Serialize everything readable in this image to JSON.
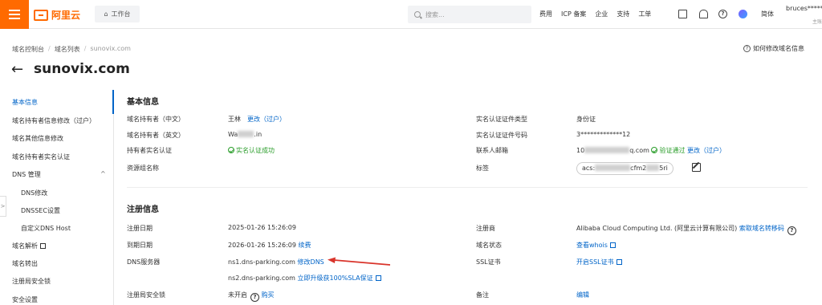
{
  "topbar": {
    "logo_text": "阿里云",
    "workbench_label": "工作台",
    "search_placeholder": "搜索...",
    "nav_links": [
      "费用",
      "ICP 备案",
      "企业",
      "支持",
      "工单"
    ],
    "language": "简体",
    "user_name": "bruces******",
    "user_sub": "主账"
  },
  "breadcrumb": [
    "域名控制台",
    "域名列表",
    "sunovix.com"
  ],
  "howto_label": "如何修改域名信息",
  "page_title": "sunovix.com",
  "sidebar": {
    "items": [
      "基本信息",
      "域名持有者信息修改（过户）",
      "域名其他信息修改",
      "域名持有者实名认证",
      "DNS 管理",
      "DNS修改",
      "DNSSEC设置",
      "自定义DNS Host",
      "域名解析",
      "域名转出",
      "注册局安全锁",
      "安全设置"
    ]
  },
  "basic_info": {
    "title": "基本信息",
    "holder_cn_label": "域名持有者（中文）",
    "holder_cn_value": "王林",
    "holder_cn_link": "更改（过户）",
    "holder_en_label": "域名持有者（英文）",
    "holder_en_prefix": "Wa",
    "holder_en_suffix": ".in",
    "realname_label": "持有者实名认证",
    "realname_value": "实名认证成功",
    "resource_group_label": "资源组名称",
    "cert_type_label": "实名认证证件类型",
    "cert_type_value": "身份证",
    "cert_no_label": "实名认证证件号码",
    "cert_no_value": "3*************12",
    "email_label": "联系人邮箱",
    "email_prefix": "10",
    "email_suffix": "q.com",
    "email_verified": "验证通过",
    "email_link": "更改（过户）",
    "tag_label": "标签",
    "tag_value_prefix": "acs:",
    "tag_value_mid": "cfm2",
    "tag_value_suffix": "5ri"
  },
  "register_info": {
    "title": "注册信息",
    "reg_date_label": "注册日期",
    "reg_date_value": "2025-01-26 15:26:09",
    "exp_date_label": "到期日期",
    "exp_date_value": "2026-01-26 15:26:09",
    "renew_link": "续费",
    "dns_label": "DNS服务器",
    "dns1": "ns1.dns-parking.com",
    "dns_modify_link": "修改DNS",
    "dns2": "ns2.dns-parking.com",
    "sla_link": "立即升级获100%SLA保证",
    "lock_label": "注册局安全锁",
    "lock_value": "未开启",
    "buy_link": "购买",
    "registrar_label": "注册商",
    "registrar_value": "Alibaba Cloud Computing Ltd. (阿里云计算有限公司)",
    "transfer_code_link": "索取域名转移码",
    "status_label": "域名状态",
    "whois_link": "查看whois",
    "ssl_label": "SSL证书",
    "ssl_link": "开启SSL证书",
    "remark_label": "备注",
    "edit_link": "编辑"
  },
  "colors": {
    "brand": "#ff6a00",
    "link": "#0064c8",
    "success": "#2a9d2a",
    "annotation_arrow": "#d9342b"
  }
}
